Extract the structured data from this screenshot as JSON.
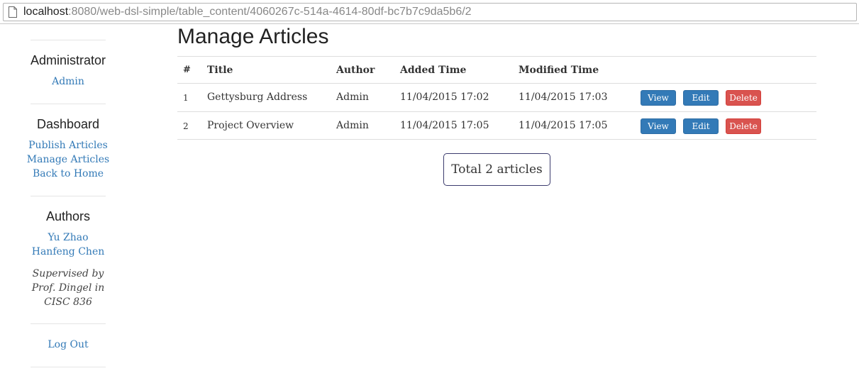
{
  "browser": {
    "url_host": "localhost",
    "url_rest": ":8080/web-dsl-simple/table_content/4060267c-514a-4614-80df-bc7b7c9da5b6/2"
  },
  "sidebar": {
    "administrator_heading": "Administrator",
    "admin_link": "Admin",
    "dashboard_heading": "Dashboard",
    "dashboard_links": [
      "Publish Articles",
      "Manage Articles",
      "Back to Home"
    ],
    "authors_heading": "Authors",
    "authors": [
      "Yu Zhao",
      "Hanfeng Chen"
    ],
    "note_lines": [
      "Supervised by",
      "Prof. Dingel in",
      "CISC 836"
    ],
    "logout": "Log Out"
  },
  "main": {
    "title": "Manage Articles",
    "columns": [
      "#",
      "Title",
      "Author",
      "Added Time",
      "Modified Time"
    ],
    "rows": [
      {
        "num": "1",
        "title": "Gettysburg Address",
        "author": "Admin",
        "added": "11/04/2015 17:02",
        "modified": "11/04/2015 17:03"
      },
      {
        "num": "2",
        "title": "Project Overview",
        "author": "Admin",
        "added": "11/04/2015 17:05",
        "modified": "11/04/2015 17:05"
      }
    ],
    "actions": {
      "view": "View",
      "edit": "Edit",
      "delete": "Delete"
    },
    "total": "Total 2 articles"
  },
  "colors": {
    "link": "#337ab7",
    "primary_button": "#337ab7",
    "danger_button": "#d9534f"
  },
  "icons": {
    "address_bar": "page-icon"
  }
}
